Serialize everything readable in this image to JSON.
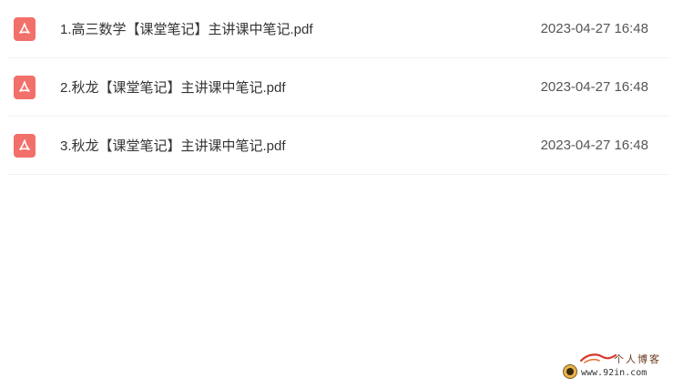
{
  "files": [
    {
      "name": "1.高三数学【课堂笔记】主讲课中笔记.pdf",
      "date": "2023-04-27 16:48",
      "icon": "pdf-icon"
    },
    {
      "name": "2.秋龙【课堂笔记】主讲课中笔记.pdf",
      "date": "2023-04-27 16:48",
      "icon": "pdf-icon"
    },
    {
      "name": "3.秋龙【课堂笔记】主讲课中笔记.pdf",
      "date": "2023-04-27 16:48",
      "icon": "pdf-icon"
    }
  ],
  "watermark": {
    "title": "个人博客",
    "url": "www.92in.com"
  },
  "colors": {
    "pdf_icon": "#f2706a",
    "row_divider": "#f2f2f2",
    "text": "#333333",
    "date_text": "#555555"
  }
}
